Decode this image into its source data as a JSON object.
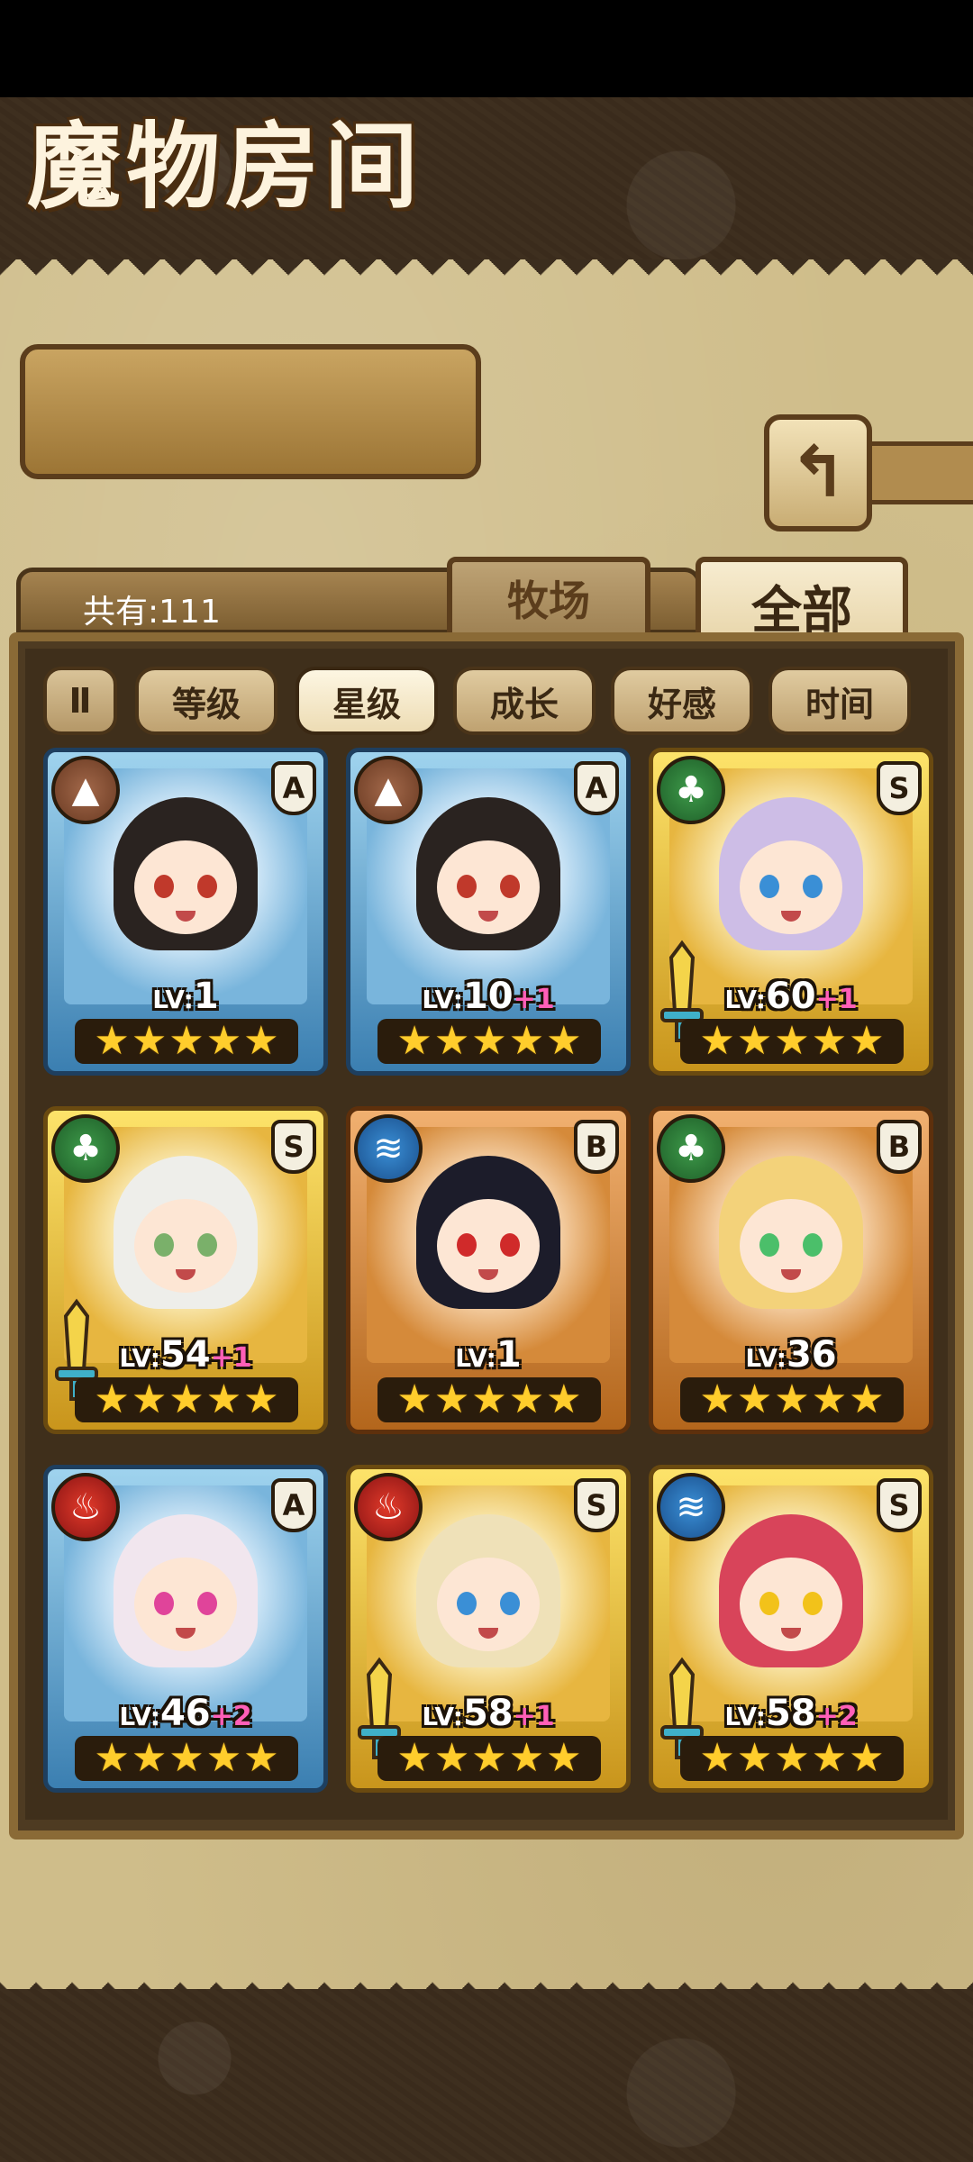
{
  "header": {
    "title": "魔物房间",
    "back_icon": "back-arrow-icon",
    "count_label": "共有:111"
  },
  "tabs": [
    {
      "label": "牧场",
      "selected": false
    },
    {
      "label": "全部",
      "selected": true
    }
  ],
  "sort": {
    "toggle_label": "Ⅱ",
    "buttons": [
      "等级",
      "星级",
      "成长",
      "好感",
      "时间"
    ],
    "active": "星级"
  },
  "colors": {
    "parchment": "#cfbd8a",
    "frame_brown": "#5b3d1c",
    "bonus_pink": "#ff5fb8",
    "star_gold": "#ffcd2c"
  },
  "cards": [
    {
      "element": "earth",
      "rank": "A",
      "lv_prefix": "LV:",
      "level": "1",
      "bonus": "",
      "stars": 5,
      "has_weapon": false,
      "hair": "#2a2320",
      "eye": "#c0392b"
    },
    {
      "element": "earth",
      "rank": "A",
      "lv_prefix": "LV:",
      "level": "10",
      "bonus": "+1",
      "stars": 5,
      "has_weapon": false,
      "hair": "#2a2320",
      "eye": "#c0392b"
    },
    {
      "element": "wood",
      "rank": "S",
      "lv_prefix": "LV:",
      "level": "60",
      "bonus": "+1",
      "stars": 5,
      "has_weapon": true,
      "hair": "#cdbde6",
      "eye": "#3a8fd6"
    },
    {
      "element": "wood",
      "rank": "S",
      "lv_prefix": "LV:",
      "level": "54",
      "bonus": "+1",
      "stars": 5,
      "has_weapon": true,
      "hair": "#eeeeea",
      "eye": "#7ab06a"
    },
    {
      "element": "water",
      "rank": "B",
      "lv_prefix": "LV:",
      "level": "1",
      "bonus": "",
      "stars": 5,
      "has_weapon": false,
      "hair": "#1c1c2a",
      "eye": "#d02a2a"
    },
    {
      "element": "wood",
      "rank": "B",
      "lv_prefix": "LV:",
      "level": "36",
      "bonus": "",
      "stars": 5,
      "has_weapon": false,
      "hair": "#f3d27a",
      "eye": "#4bbf6a"
    },
    {
      "element": "fire",
      "rank": "A",
      "lv_prefix": "LV:",
      "level": "46",
      "bonus": "+2",
      "stars": 5,
      "has_weapon": false,
      "hair": "#f1e6ee",
      "eye": "#e0449a"
    },
    {
      "element": "fire",
      "rank": "S",
      "lv_prefix": "LV:",
      "level": "58",
      "bonus": "+1",
      "stars": 5,
      "has_weapon": true,
      "hair": "#efe1b8",
      "eye": "#3a8fd6"
    },
    {
      "element": "water",
      "rank": "S",
      "lv_prefix": "LV:",
      "level": "58",
      "bonus": "+2",
      "stars": 5,
      "has_weapon": true,
      "hair": "#d8445a",
      "eye": "#f2c21a"
    }
  ]
}
